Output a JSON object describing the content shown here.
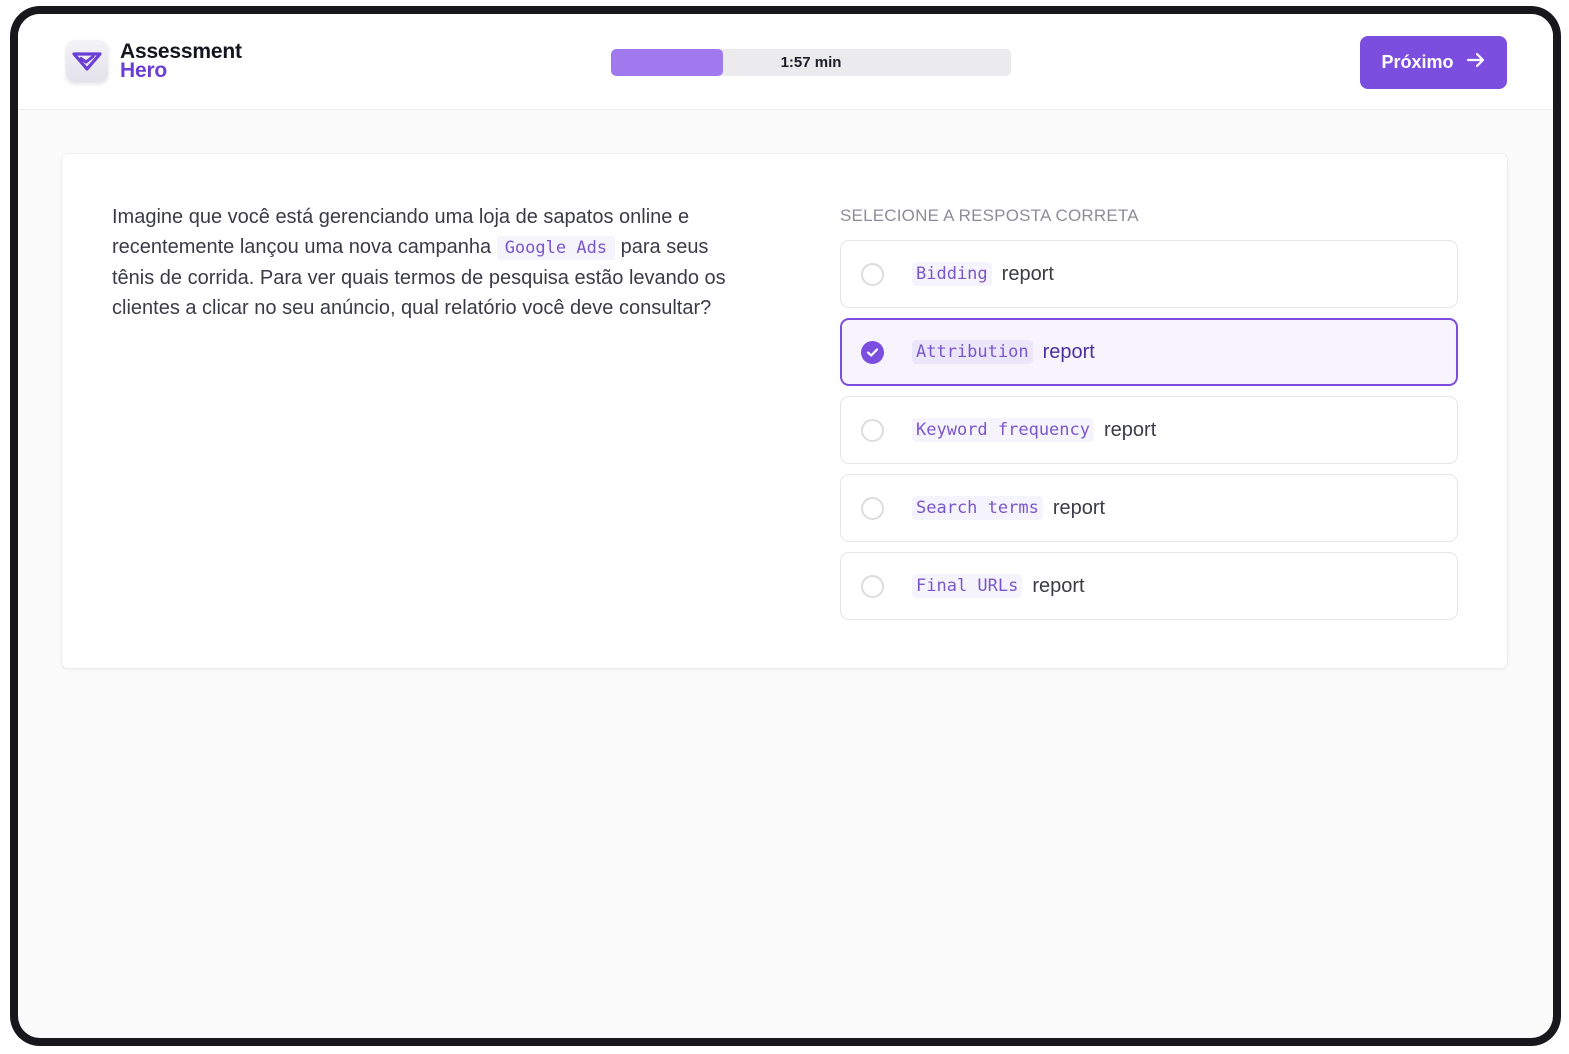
{
  "app": {
    "logo_line1": "Assessment",
    "logo_line2": "Hero"
  },
  "header": {
    "timer_text": "1:57 min",
    "timer_progress_fraction": 0.28,
    "next_label": "Próximo"
  },
  "question": {
    "text_before": "Imagine que você está gerenciando uma loja de sapatos online e recentemente lançou uma nova campanha ",
    "code": "Google Ads",
    "text_after": " para seus tênis de corrida. Para ver quais termos de pesquisa estão levando os clientes a clicar no seu anúncio, qual relatório você deve consultar?"
  },
  "answers": {
    "heading": "SELECIONE A RESPOSTA CORRETA",
    "options": [
      {
        "code": "Bidding",
        "suffix": "report",
        "selected": false
      },
      {
        "code": "Attribution",
        "suffix": "report",
        "selected": true
      },
      {
        "code": "Keyword frequency",
        "suffix": "report",
        "selected": false
      },
      {
        "code": "Search terms",
        "suffix": "report",
        "selected": false
      },
      {
        "code": "Final URLs",
        "suffix": "report",
        "selected": false
      }
    ]
  },
  "colors": {
    "accent": "#7b4ee0",
    "brand_text": "#6b3fd4",
    "timer_fill": "#a179ee"
  },
  "icons": {
    "logo": "diamond-check-icon",
    "next": "arrow-right-icon",
    "selected": "check-icon"
  }
}
